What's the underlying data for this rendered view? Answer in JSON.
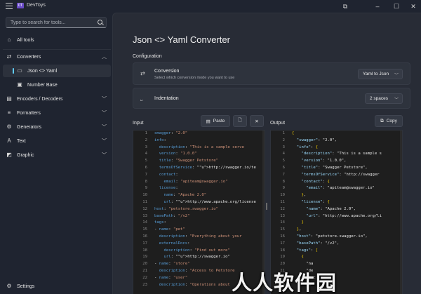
{
  "app": {
    "title": "DevToys",
    "logo_text": "DT"
  },
  "search": {
    "placeholder": "Type to search for tools..."
  },
  "sidebar": {
    "all_tools": "All tools",
    "groups": [
      {
        "label": "Converters",
        "icon": "converters-icon",
        "expanded": true
      },
      {
        "label": "Encoders / Decoders",
        "icon": "encoders-icon"
      },
      {
        "label": "Formatters",
        "icon": "formatters-icon"
      },
      {
        "label": "Generators",
        "icon": "generators-icon"
      },
      {
        "label": "Text",
        "icon": "text-icon"
      },
      {
        "label": "Graphic",
        "icon": "graphic-icon"
      }
    ],
    "converter_items": [
      {
        "label": "Json <> Yaml",
        "icon": "json-yaml-icon",
        "selected": true
      },
      {
        "label": "Number Base",
        "icon": "number-base-icon"
      }
    ],
    "settings": "Settings"
  },
  "main": {
    "title": "Json <> Yaml Converter",
    "configuration_label": "Configuration",
    "conversion": {
      "title": "Conversion",
      "description": "Select which conversion mode you want to use",
      "value": "Yaml to Json"
    },
    "indentation": {
      "title": "Indentation",
      "value": "2 spaces"
    },
    "input": {
      "label": "Input",
      "paste_label": "Paste"
    },
    "output": {
      "label": "Output",
      "copy_label": "Copy"
    }
  },
  "input_lines": [
    "smagger: \"2.0\"",
    "info:",
    "  description: \"This is a sample serve",
    "  version: \"1.0.0\"",
    "  title: \"Swagger Petstore\"",
    "  termsOfService: \"http://swagger.io/te",
    "  contact:",
    "    email: \"apiteam@swagger.io\"",
    "  license:",
    "    name: \"Apache 2.0\"",
    "    url: \"http://www.apache.org/license",
    "host: \"petstore.swagger.io\"",
    "basePath: \"/v2\"",
    "tags:",
    "- name: \"pet\"",
    "  description: \"Everything about your",
    "  externalDocs:",
    "    description: \"Find out more\"",
    "    url: \"http://swagger.io\"",
    "- name: \"store\"",
    "  description: \"Access to Petstore",
    "- name: \"user\"",
    "  description: \"Operations about"
  ],
  "output_lines": [
    "{",
    "  \"swagger\": \"2.0\",",
    "  \"info\": {",
    "    \"description\": \"This is a sample s",
    "    \"version\": \"1.0.0\",",
    "    \"title\": \"Swagger Petstore\",",
    "    \"termsOfService\": \"http://swagger",
    "    \"contact\": {",
    "      \"email\": \"apiteam@swagger.io\"",
    "    },",
    "    \"license\": {",
    "      \"name\": \"Apache 2.0\",",
    "      \"url\": \"http://www.apache.org/li",
    "    }",
    "  },",
    "  \"host\": \"petstore.swagger.io\",",
    "  \"basePath\": \"/v2\",",
    "  \"tags\": [",
    "    {",
    "      \"na",
    "      \"de",
    "      \"Doc",
    "      \"u"
  ],
  "watermark": "人人软件园",
  "colors": {
    "accent": "#60cdff",
    "sidebar_bg": "#1f2430",
    "content_bg": "#282c36",
    "editor_bg": "#1e1e1e"
  }
}
